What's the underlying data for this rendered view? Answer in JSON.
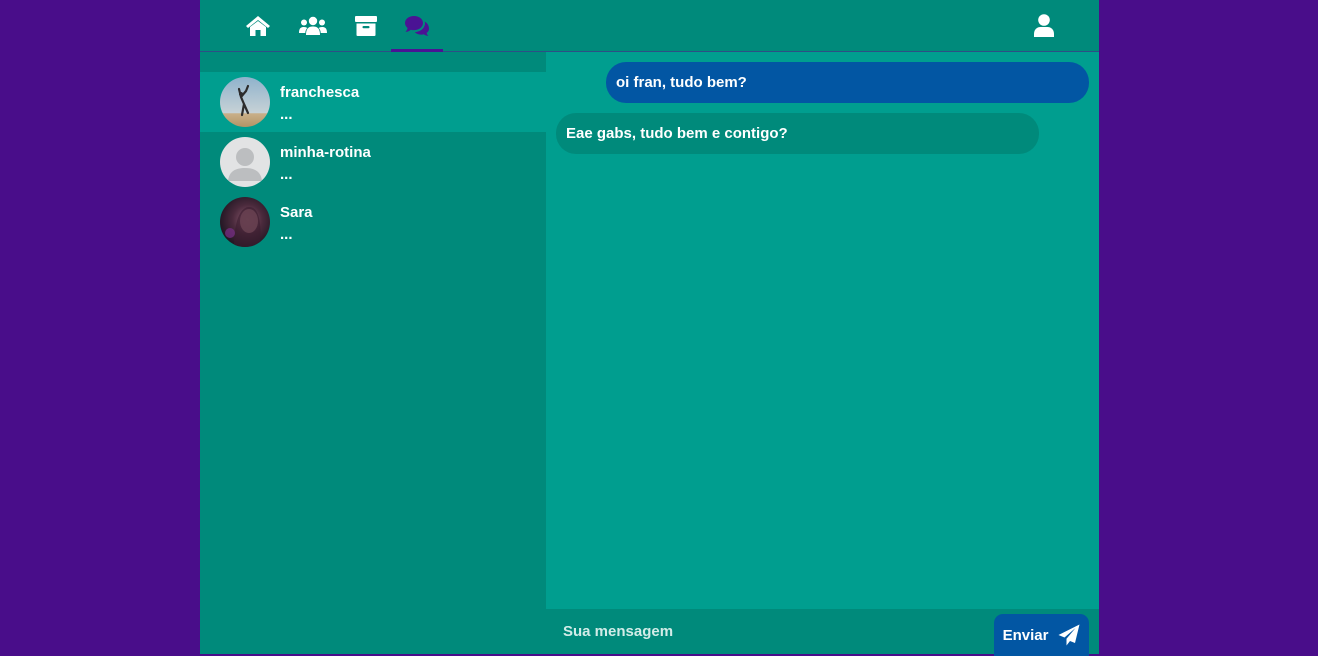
{
  "nav": {
    "items": [
      {
        "icon": "home-icon"
      },
      {
        "icon": "users-icon"
      },
      {
        "icon": "archive-icon"
      },
      {
        "icon": "chat-bubbles-icon",
        "active": true
      }
    ],
    "profile_icon": "user-icon",
    "active_color": "#4a1394"
  },
  "conversations": [
    {
      "name": "franchesca",
      "preview": "...",
      "active": true
    },
    {
      "name": "minha-rotina",
      "preview": "..."
    },
    {
      "name": "Sara",
      "preview": "..."
    }
  ],
  "messages": [
    {
      "direction": "sent",
      "text": "oi fran, tudo bem?"
    },
    {
      "direction": "received",
      "text": "Eae gabs, tudo bem e contigo?"
    }
  ],
  "composer": {
    "placeholder": "Sua mensagem",
    "send_label": "Enviar",
    "send_icon": "paper-plane-icon"
  },
  "colors": {
    "background": "#490d8a",
    "panel": "#008a7b",
    "panel_active": "#009e8f",
    "sent_bubble": "#0256a3"
  }
}
